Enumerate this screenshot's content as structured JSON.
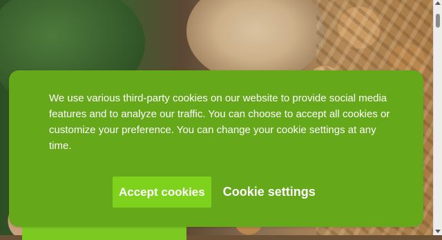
{
  "cookie_banner": {
    "message": "We use various third-party cookies on our website to provide social media features and to analyze our traffic. You can choose to accept all cookies or customize your preference. You can change your cookie settings at any time.",
    "accept_label": "Accept cookies",
    "settings_label": "Cookie settings"
  },
  "colors": {
    "banner_green": "#65a91a",
    "accept_green": "#7fd21c",
    "text": "#ffffff"
  }
}
